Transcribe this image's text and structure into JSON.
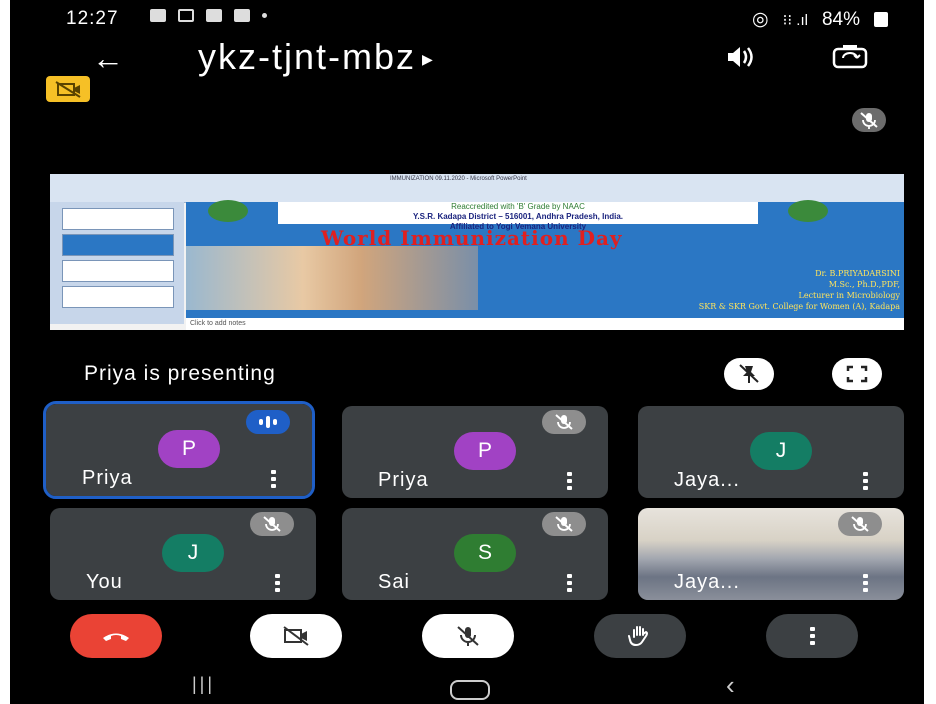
{
  "status_bar": {
    "time": "12:27",
    "battery": "84%"
  },
  "app_bar": {
    "meeting_code": "ykz-tjnt-mbz"
  },
  "presentation": {
    "banner": "Priya is presenting",
    "slide": {
      "window_title": "IMMUNIZATION 09.11.2020 - Microsoft PowerPoint",
      "header_line1": "Reaccredited with 'B' Grade by NAAC",
      "header_line2": "Y.S.R. Kadapa District – 516001, Andhra Pradesh, India.",
      "header_line3": "Affiliated to Yogi Vemana University",
      "title": "World Immunization Day",
      "author_name": "Dr. B.PRIYADARSINI",
      "author_quals": "M.Sc., Ph.D.,PDF,",
      "author_role": "Lecturer in Microbiology",
      "author_college": "SKR & SKR Govt. College for Women (A), Kadapa",
      "notes_placeholder": "Click to add notes"
    }
  },
  "participants": [
    {
      "name": "Priya",
      "initial": "P",
      "color": "#a142c4",
      "state": "speaking"
    },
    {
      "name": "Priya",
      "initial": "P",
      "color": "#a142c4",
      "state": "muted"
    },
    {
      "name": "Jaya...",
      "initial": "J",
      "color": "#147d64",
      "state": "none"
    },
    {
      "name": "You",
      "initial": "J",
      "color": "#147d64",
      "state": "muted"
    },
    {
      "name": "Sai",
      "initial": "S",
      "color": "#2f7d32",
      "state": "muted"
    },
    {
      "name": "Jaya...",
      "initial": "",
      "color": "",
      "state": "video-muted"
    }
  ],
  "colors": {
    "end_call": "#ea4335",
    "highlight": "#1f5fc7",
    "badge": "#f6c026"
  },
  "icons": [
    "back-arrow-icon",
    "speaker-icon",
    "switch-camera-icon",
    "video-off-badge-icon",
    "mic-off-icon",
    "pin-off-icon",
    "fullscreen-icon",
    "more-vert-icon",
    "end-call-icon",
    "camera-off-icon",
    "raise-hand-icon"
  ]
}
